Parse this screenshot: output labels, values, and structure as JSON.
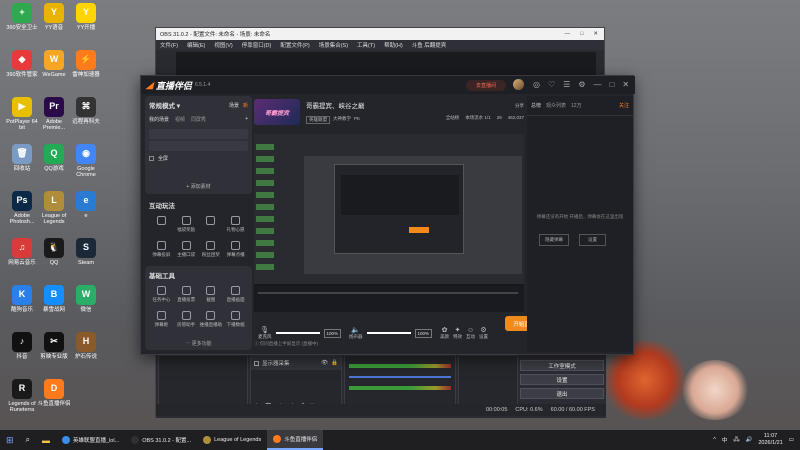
{
  "desktop": {
    "icons": [
      {
        "label": "360安全卫士",
        "color": "#2fa84f",
        "glyph": "+"
      },
      {
        "label": "YY语音",
        "color": "#e8b400",
        "glyph": "Y"
      },
      {
        "label": "YY开播",
        "color": "#ffd400",
        "glyph": "Y"
      },
      {
        "label": "360软件管家",
        "color": "#e83a3a",
        "glyph": "◆"
      },
      {
        "label": "WeGame",
        "color": "#f5a623",
        "glyph": "W"
      },
      {
        "label": "雷神加速器",
        "color": "#ff7a1a",
        "glyph": "⚡"
      },
      {
        "label": "PotPlayer 64 bit",
        "color": "#e8c000",
        "glyph": "▶"
      },
      {
        "label": "Adobe Premie...",
        "color": "#2a0a48",
        "glyph": "Pr"
      },
      {
        "label": "远程再科夫",
        "color": "#333",
        "glyph": "⌘"
      },
      {
        "label": "回收站",
        "color": "#7a9cc4",
        "glyph": "🗑"
      },
      {
        "label": "QQ游戏",
        "color": "#22aa55",
        "glyph": "Q"
      },
      {
        "label": "Google Chrome",
        "color": "#4285f4",
        "glyph": "◉"
      },
      {
        "label": "Adobe Photosh...",
        "color": "#0c2a48",
        "glyph": "Ps"
      },
      {
        "label": "League of Legends",
        "color": "#b08d3a",
        "glyph": "L"
      },
      {
        "label": "e",
        "color": "#2a7bd4",
        "glyph": "e"
      },
      {
        "label": "网易云音乐",
        "color": "#d93a3a",
        "glyph": "♫"
      },
      {
        "label": "QQ",
        "color": "#1a1a1a",
        "glyph": "🐧"
      },
      {
        "label": "Steam",
        "color": "#1b2838",
        "glyph": "S"
      },
      {
        "label": "酷狗音乐",
        "color": "#2a7fe8",
        "glyph": "K"
      },
      {
        "label": "暴雪战网",
        "color": "#148eff",
        "glyph": "B"
      },
      {
        "label": "微信",
        "color": "#2aae67",
        "glyph": "W"
      },
      {
        "label": "抖音",
        "color": "#111",
        "glyph": "♪"
      },
      {
        "label": "剪映专业版",
        "color": "#111",
        "glyph": "✂"
      },
      {
        "label": "炉石传说",
        "color": "#8a5a2a",
        "glyph": "H"
      },
      {
        "label": "Legends of Runeterra",
        "color": "#1a1a1a",
        "glyph": "R"
      },
      {
        "label": "斗鱼直播伴侣",
        "color": "#ff7a1a",
        "glyph": "D"
      }
    ]
  },
  "obs": {
    "title": "OBS 31.0.2 - 配置文件: 未命名 - 场景: 未命名",
    "window_controls": [
      "—",
      "□",
      "✕"
    ],
    "menu": [
      "文件(F)",
      "编辑(E)",
      "视图(V)",
      "停靠窗口(D)",
      "配置文件(P)",
      "场景集合(S)",
      "工具(T)",
      "帮助(H)",
      "斗鱼 后翻提宾"
    ],
    "source_item": "显示器采集",
    "controls": [
      "工作室模式",
      "设置",
      "退出"
    ],
    "status": {
      "time": "00:00:05",
      "cpu": "CPU: 0.6%",
      "fps": "60.00 / 60.00 FPS"
    }
  },
  "companion": {
    "app_name": "直播伴侣",
    "version": "6.5.1.4",
    "live_label": "去直播间",
    "top_icons": [
      "◎",
      "♡",
      "☰",
      "⚙",
      "—",
      "□",
      "✕"
    ],
    "left_panel": {
      "mode": "常规模式 ▾",
      "tabs": [
        "场景",
        "新"
      ],
      "sub_tabs": [
        "我的场景",
        "视频",
        "同屏秀"
      ],
      "sources": [
        "全屏"
      ],
      "add_source": "+ 添加素材"
    },
    "interactive": {
      "title": "互动玩法",
      "items": [
        "",
        "福袋奖励",
        "",
        "礼物心愿",
        "弹幕投屏",
        "主播口袋",
        "粉丝团奖",
        "弹幕点播"
      ]
    },
    "basic_tools": {
      "title": "基础工具",
      "items": [
        "任务中心",
        "直播投票",
        "截图",
        "直播画面",
        "弹幕姬",
        "房管助手",
        "维播直播助",
        "下播数据"
      ],
      "more": "⋯ 更多功能"
    },
    "room": {
      "title": "哥霸提宾、峡谷之巅",
      "thumb_text": "哥霸提宾",
      "tag1": "英雄联盟",
      "tag2": "大神教学",
      "tag3": "PK",
      "share": "分享",
      "stats": [
        "全站榜",
        "本场流水 1/1",
        "28",
        "462,037"
      ]
    },
    "controls": {
      "mic": "麦克风",
      "mic_pct": "100%",
      "speaker": "扬声器",
      "speaker_pct": "100%",
      "beauty": "美颜",
      "effects": "特效",
      "interact": "互动",
      "settings": "设置",
      "start_live": "开始直播(Y)"
    },
    "bottom_note": "ⓘ 仅同直播上半屏显示 (直播中)",
    "right": {
      "tabs": [
        "总榜",
        "观众列表"
      ],
      "count": "12万",
      "follow": "关注",
      "empty_text": "弹幕还没有开始 开播后，弹幕会在这里出现",
      "btn1": "隐藏弹幕",
      "btn2": "设置"
    }
  },
  "taskbar": {
    "items": [
      {
        "label": "英雄联盟直播_lol...",
        "color": "#3a8ee8"
      },
      {
        "label": "OBS 31.0.2 - 配置...",
        "color": "#303030"
      },
      {
        "label": "League of Legends",
        "color": "#b08d3a"
      },
      {
        "label": "斗鱼直播伴侣",
        "color": "#ff7a1a"
      }
    ],
    "clock_time": "11:07",
    "clock_date": "2026/1/21",
    "lang": "中"
  }
}
